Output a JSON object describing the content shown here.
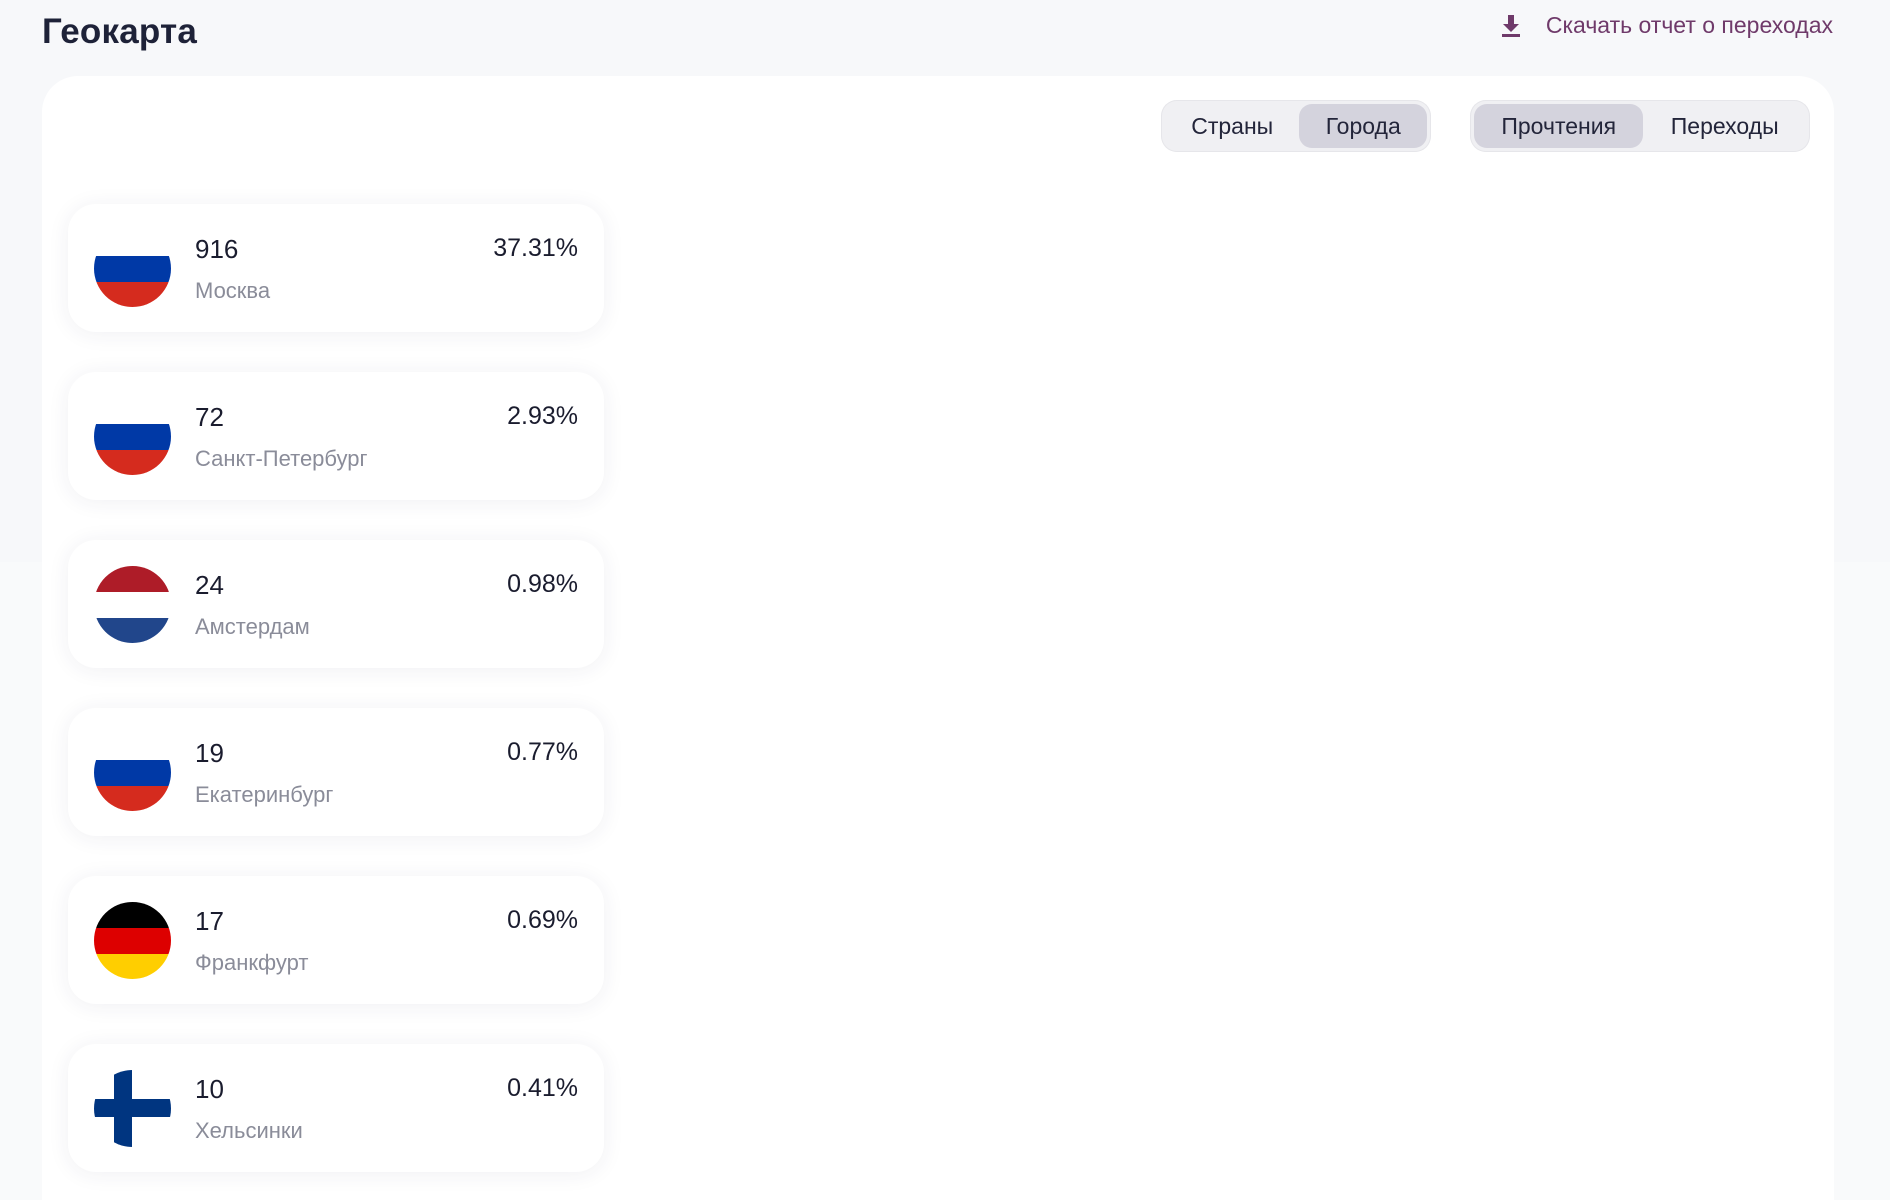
{
  "header": {
    "title": "Геокарта",
    "download_label": "Скачать отчет о переходах",
    "download_icon": "download-icon"
  },
  "toggles": {
    "geo": [
      {
        "label": "Страны",
        "active": false
      },
      {
        "label": "Города",
        "active": true
      }
    ],
    "metric": [
      {
        "label": "Прочтения",
        "active": true
      },
      {
        "label": "Переходы",
        "active": false
      }
    ]
  },
  "colors": {
    "accent_link": "#6f3a6a",
    "active_segment": "#d4d3dd",
    "russia": [
      "#ffffff",
      "#0039a6",
      "#d52b1e"
    ],
    "netherlands": [
      "#ae1c28",
      "#ffffff",
      "#21468b"
    ],
    "germany": [
      "#000000",
      "#dd0000",
      "#ffce00"
    ],
    "finland": [
      "#ffffff",
      "#003580"
    ]
  },
  "cities": [
    {
      "count": "916",
      "city": "Москва",
      "percent": "37.31%",
      "flag": "russia-flag-icon"
    },
    {
      "count": "72",
      "city": "Санкт-Петербург",
      "percent": "2.93%",
      "flag": "russia-flag-icon"
    },
    {
      "count": "24",
      "city": "Амстердам",
      "percent": "0.98%",
      "flag": "netherlands-flag-icon"
    },
    {
      "count": "19",
      "city": "Екатеринбург",
      "percent": "0.77%",
      "flag": "russia-flag-icon"
    },
    {
      "count": "17",
      "city": "Франкфурт",
      "percent": "0.69%",
      "flag": "germany-flag-icon"
    },
    {
      "count": "10",
      "city": "Хельсинки",
      "percent": "0.41%",
      "flag": "finland-flag-icon"
    }
  ]
}
